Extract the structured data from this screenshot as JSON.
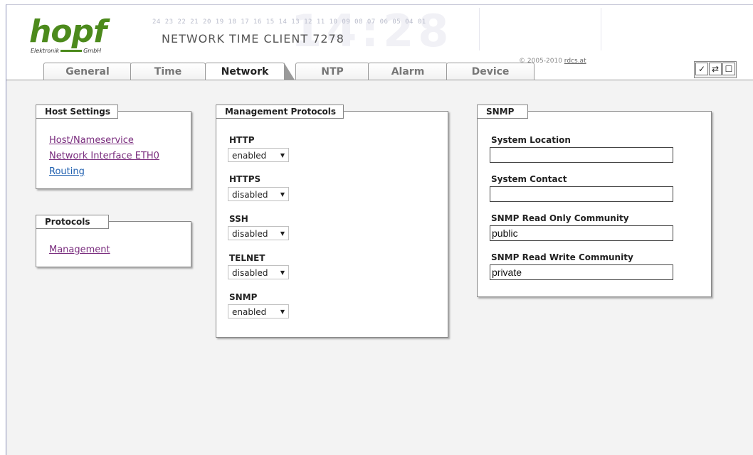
{
  "header": {
    "logo_text": "hopf",
    "logo_sub_left": "Elektronik",
    "logo_sub_right": "GmbH",
    "hour_scale": "24 23 22 21 20 19 18 17 16 15 14 13 12 11 10 09 08 07 06 05 04 01",
    "product_name": "NETWORK TIME CLIENT 7278",
    "background_digits": "14:28",
    "copyright_text": "© 2005-2010",
    "copyright_link": "rdcs.at"
  },
  "tabs": [
    {
      "label": "General",
      "active": false
    },
    {
      "label": "Time",
      "active": false
    },
    {
      "label": "Network",
      "active": true
    },
    {
      "label": "NTP",
      "active": false
    },
    {
      "label": "Alarm",
      "active": false
    },
    {
      "label": "Device",
      "active": false
    }
  ],
  "toolbar": {
    "apply_icon": "✓",
    "reload_icon": "⇄",
    "save_icon": "☐"
  },
  "host_settings": {
    "title": "Host Settings",
    "links": [
      {
        "label": "Host/Nameservice",
        "visited": true
      },
      {
        "label": "Network Interface ETH0",
        "visited": true
      },
      {
        "label": "Routing",
        "visited": false
      }
    ]
  },
  "protocols": {
    "title": "Protocols",
    "links": [
      {
        "label": "Management",
        "visited": true
      }
    ]
  },
  "management": {
    "title": "Management Protocols",
    "fields": [
      {
        "label": "HTTP",
        "value": "enabled"
      },
      {
        "label": "HTTPS",
        "value": "disabled"
      },
      {
        "label": "SSH",
        "value": "disabled"
      },
      {
        "label": "TELNET",
        "value": "disabled"
      },
      {
        "label": "SNMP",
        "value": "enabled"
      }
    ]
  },
  "snmp": {
    "title": "SNMP",
    "fields": [
      {
        "label": "System Location",
        "value": ""
      },
      {
        "label": "System Contact",
        "value": ""
      },
      {
        "label": "SNMP Read Only Community",
        "value": "public"
      },
      {
        "label": "SNMP Read Write Community",
        "value": "private"
      }
    ]
  }
}
